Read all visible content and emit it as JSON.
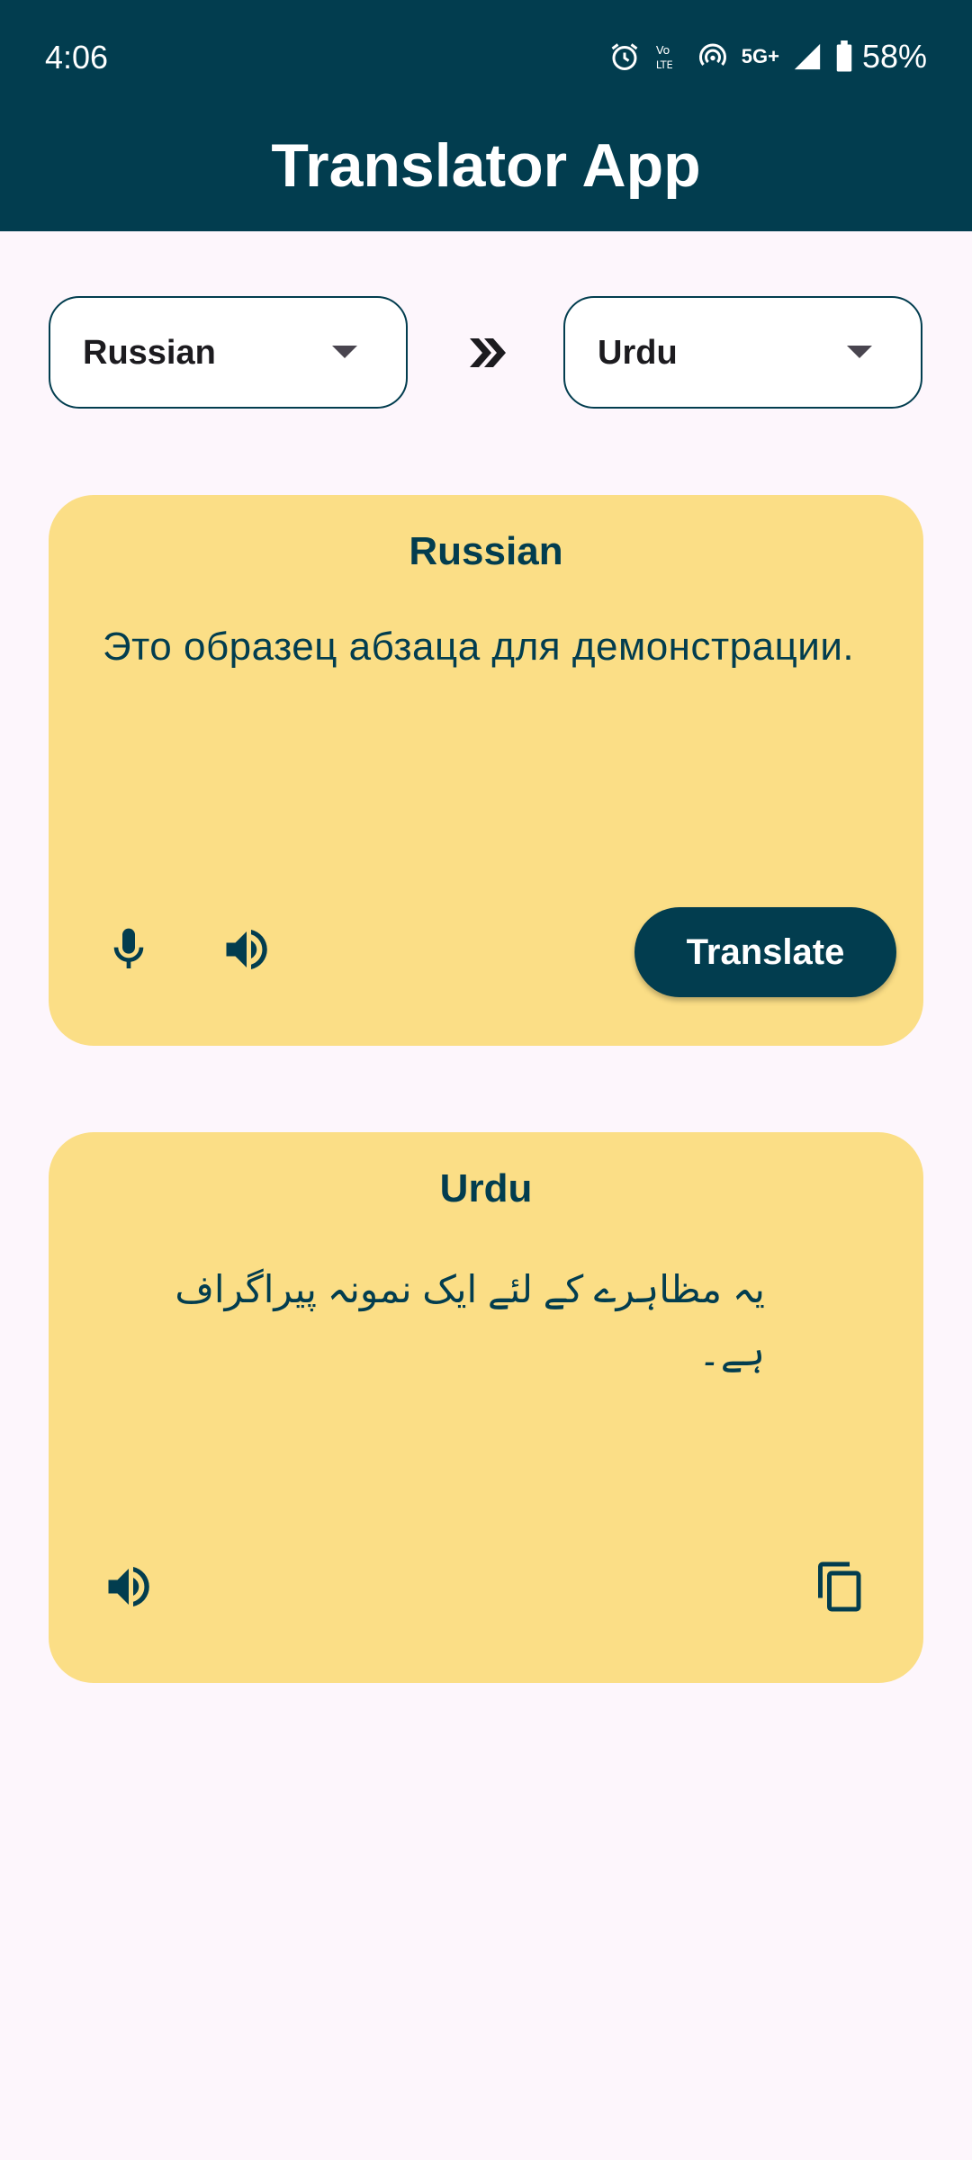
{
  "status_bar": {
    "time": "4:06",
    "network_label": "5G+",
    "battery_percent": "58%"
  },
  "header": {
    "title": "Translator App"
  },
  "language_picker": {
    "source_language": "Russian",
    "target_language": "Urdu",
    "swap_icon": "double-chevron-right-icon"
  },
  "source_card": {
    "title": "Russian",
    "text": "Это образец абзаца для демонстрации.",
    "mic_icon": "microphone-icon",
    "speaker_icon": "speaker-icon",
    "translate_label": "Translate"
  },
  "result_card": {
    "title": "Urdu",
    "text": "یہ مظاہرے کے لئے ایک نمونہ پیراگراف ہے۔",
    "speaker_icon": "speaker-icon",
    "copy_icon": "copy-icon"
  },
  "colors": {
    "primary": "#023d4f",
    "card_background": "#fbde86",
    "page_background": "#fdf6fc"
  }
}
